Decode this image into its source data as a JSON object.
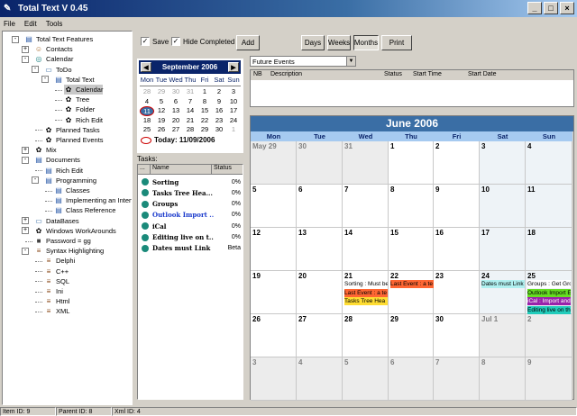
{
  "window": {
    "title": "Total Text V 0.45",
    "buttons": [
      "_",
      "□",
      "×"
    ]
  },
  "menu": [
    "File",
    "Edit",
    "Tools"
  ],
  "tree": [
    {
      "label": "Total Text Features",
      "level": 0,
      "exp": "-",
      "icon": "doc-icon"
    },
    {
      "label": "Contacts",
      "level": 1,
      "exp": "+",
      "icon": "contacts-icon"
    },
    {
      "label": "Calendar",
      "level": 1,
      "exp": "-",
      "icon": "calendar-icon"
    },
    {
      "label": "ToDo",
      "level": 2,
      "exp": "-",
      "icon": "folder-icon"
    },
    {
      "label": "Total Text",
      "level": 3,
      "exp": "-",
      "icon": "doc-icon"
    },
    {
      "label": "Calendar",
      "level": 4,
      "exp": "",
      "icon": "gear-icon",
      "selected": true
    },
    {
      "label": "Tree",
      "level": 4,
      "exp": "",
      "icon": "gear-icon"
    },
    {
      "label": "Folder",
      "level": 4,
      "exp": "",
      "icon": "gear-icon"
    },
    {
      "label": "Rich Edit",
      "level": 4,
      "exp": "",
      "icon": "gear-icon"
    },
    {
      "label": "Planned Tasks",
      "level": 2,
      "exp": "",
      "icon": "gear-icon"
    },
    {
      "label": "Planned Events",
      "level": 2,
      "exp": "",
      "icon": "gear-icon"
    },
    {
      "label": "Mix",
      "level": 1,
      "exp": "+",
      "icon": "gear-icon"
    },
    {
      "label": "Documents",
      "level": 1,
      "exp": "-",
      "icon": "doc-icon"
    },
    {
      "label": "Rich Edit",
      "level": 2,
      "exp": "",
      "icon": "doc-icon"
    },
    {
      "label": "Programming",
      "level": 2,
      "exp": "-",
      "icon": "doc-icon"
    },
    {
      "label": "Classes",
      "level": 3,
      "exp": "",
      "icon": "doc-icon"
    },
    {
      "label": "Implementing an Interface",
      "level": 3,
      "exp": "",
      "icon": "doc-icon"
    },
    {
      "label": "Class Reference",
      "level": 3,
      "exp": "",
      "icon": "doc-icon"
    },
    {
      "label": "DataBases",
      "level": 1,
      "exp": "+",
      "icon": "folder-icon"
    },
    {
      "label": "Windows WorkArounds",
      "level": 1,
      "exp": "+",
      "icon": "gear-icon"
    },
    {
      "label": "Password = gg",
      "level": 1,
      "exp": "",
      "icon": "lock-icon"
    },
    {
      "label": "Syntax Highlighting",
      "level": 1,
      "exp": "-",
      "icon": "code-icon"
    },
    {
      "label": "Delphi",
      "level": 2,
      "exp": "",
      "icon": "code-icon"
    },
    {
      "label": "C++",
      "level": 2,
      "exp": "",
      "icon": "code-icon"
    },
    {
      "label": "SQL",
      "level": 2,
      "exp": "",
      "icon": "code-icon"
    },
    {
      "label": "Ini",
      "level": 2,
      "exp": "",
      "icon": "code-icon"
    },
    {
      "label": "Html",
      "level": 2,
      "exp": "",
      "icon": "code-icon"
    },
    {
      "label": "XML",
      "level": 2,
      "exp": "",
      "icon": "code-icon"
    }
  ],
  "toolbar": {
    "save": "Save",
    "hide_completed": "Hide Completed",
    "add": "Add",
    "days": "Days",
    "weeks": "Weeks",
    "months": "Months",
    "print": "Print"
  },
  "minical": {
    "title": "September 2006",
    "days": [
      "Mon",
      "Tue",
      "Wed",
      "Thu",
      "Fri",
      "Sat",
      "Sun"
    ],
    "weeks": [
      [
        "28",
        "29",
        "30",
        "31",
        "1",
        "2",
        "3"
      ],
      [
        "4",
        "5",
        "6",
        "7",
        "8",
        "9",
        "10"
      ],
      [
        "11",
        "12",
        "13",
        "14",
        "15",
        "16",
        "17"
      ],
      [
        "18",
        "19",
        "20",
        "21",
        "22",
        "23",
        "24"
      ],
      [
        "25",
        "26",
        "27",
        "28",
        "29",
        "30",
        "1"
      ],
      [
        "2",
        "3",
        "4",
        "5",
        "6",
        "7",
        "8"
      ]
    ],
    "today_label": "Today: 11/09/2006"
  },
  "tasks": {
    "label": "Tasks:",
    "columns": [
      "...",
      "Name",
      "Status"
    ],
    "rows": [
      {
        "name": "Sorting",
        "status": "0%"
      },
      {
        "name": "Tasks Tree Hea...",
        "status": "0%"
      },
      {
        "name": "Groups",
        "status": "0%"
      },
      {
        "name": "Outlook Import ...",
        "status": "0%",
        "blue": true
      },
      {
        "name": "iCal",
        "status": "0%"
      },
      {
        "name": "Editing live on t...",
        "status": "0%"
      },
      {
        "name": "Dates must Link",
        "status": "Beta"
      }
    ]
  },
  "filter": {
    "value": "Future Events"
  },
  "events": {
    "columns": [
      "NB",
      "Description",
      "Status",
      "Start Time",
      "Start Date"
    ]
  },
  "bigcal": {
    "title": "June 2006",
    "days": [
      "Mon",
      "Tue",
      "Wed",
      "Thu",
      "Fri",
      "Sat",
      "Sun"
    ],
    "weeks": [
      [
        "May 29",
        "30",
        "31",
        "1",
        "2",
        "3",
        "4"
      ],
      [
        "5",
        "6",
        "7",
        "8",
        "9",
        "10",
        "11"
      ],
      [
        "12",
        "13",
        "14",
        "15",
        "16",
        "17",
        "18"
      ],
      [
        "19",
        "20",
        "21",
        "22",
        "23",
        "24",
        "25"
      ],
      [
        "26",
        "27",
        "28",
        "29",
        "30",
        "Jul 1",
        "2"
      ],
      [
        "3",
        "4",
        "5",
        "6",
        "7",
        "8",
        "9"
      ]
    ],
    "events": [
      {
        "week": 3,
        "day": 2,
        "row": 0,
        "text": "Sorting : Must be",
        "color": "#ffffff"
      },
      {
        "week": 3,
        "day": 2,
        "row": 1,
        "text": "Last Event : a te",
        "color": "#ff6633"
      },
      {
        "week": 3,
        "day": 2,
        "row": 2,
        "text": "Tasks Tree Hea",
        "color": "#ffdd33"
      },
      {
        "week": 3,
        "day": 3,
        "row": 0,
        "text": "Last Event : a te",
        "color": "#ff6633"
      },
      {
        "week": 3,
        "day": 5,
        "row": 0,
        "text": "Dates must Link",
        "color": "#b0f0f0"
      },
      {
        "week": 3,
        "day": 6,
        "row": 0,
        "text": "Groups : Get Gro",
        "color": "#ffffff"
      },
      {
        "week": 3,
        "day": 6,
        "row": 1,
        "text": "Outlook Import E",
        "color": "#66dd22"
      },
      {
        "week": 3,
        "day": 6,
        "row": 2,
        "text": "iCal : Import and",
        "color": "#9922aa"
      },
      {
        "week": 3,
        "day": 6,
        "row": 3,
        "text": "Editing live on th",
        "color": "#22ccbb"
      }
    ]
  },
  "status": {
    "item": "Item ID: 9",
    "parent": "Parent ID: 8",
    "xml": "Xml ID: 4"
  }
}
